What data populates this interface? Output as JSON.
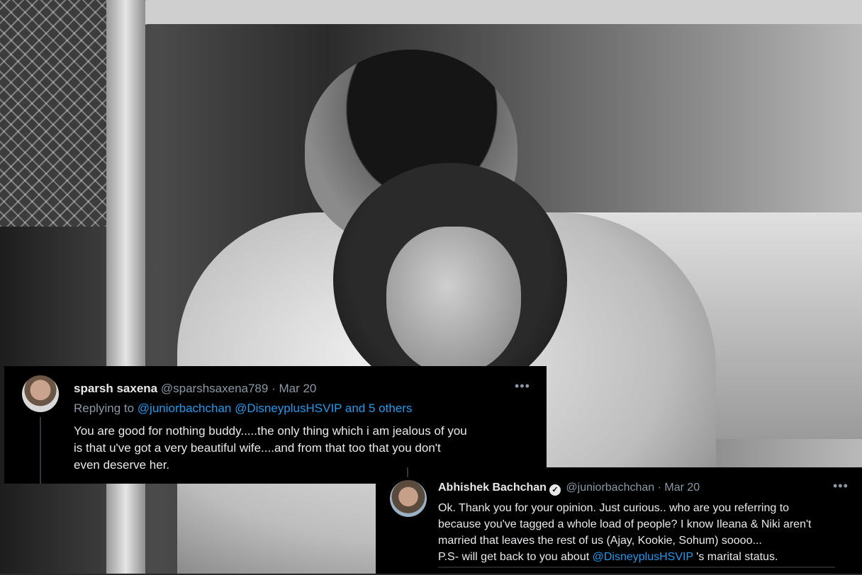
{
  "tweet_reply": {
    "display_name": "sparsh saxena",
    "handle": "@sparshsaxena789",
    "date": "· Mar 20",
    "replying_prefix": "Replying to",
    "replying_mentions": "@juniorbachchan @DisneyplusHSVIP and 5 others",
    "text_lines": [
      "You are good for nothing buddy.....the only thing which i am jealous of you",
      "is that u've got a very beautiful wife....and from that too that you don't",
      "even deserve her."
    ],
    "more_icon": "more-horizontal-icon"
  },
  "tweet_response": {
    "display_name": "Abhishek Bachchan",
    "handle": "@juniorbachchan",
    "date": "· Mar 20",
    "verified_icon": "verified-badge-icon",
    "text_lines": [
      "Ok. Thank you for your opinion. Just curious.. who are you referring to",
      "because you've tagged a whole load of people? I know Ileana & Niki aren't",
      "married that leaves the rest of us (Ajay, Kookie, Sohum) soooo..."
    ],
    "ps_prefix": "P.S- will get back to you about",
    "ps_mention": "@DisneyplusHSVIP",
    "ps_suffix": " 's marital status.",
    "more_icon": "more-horizontal-icon"
  },
  "colors": {
    "card_background": "#000000",
    "text": "#e7e9ea",
    "muted": "#8b98a5",
    "link": "#1d9bf0"
  }
}
